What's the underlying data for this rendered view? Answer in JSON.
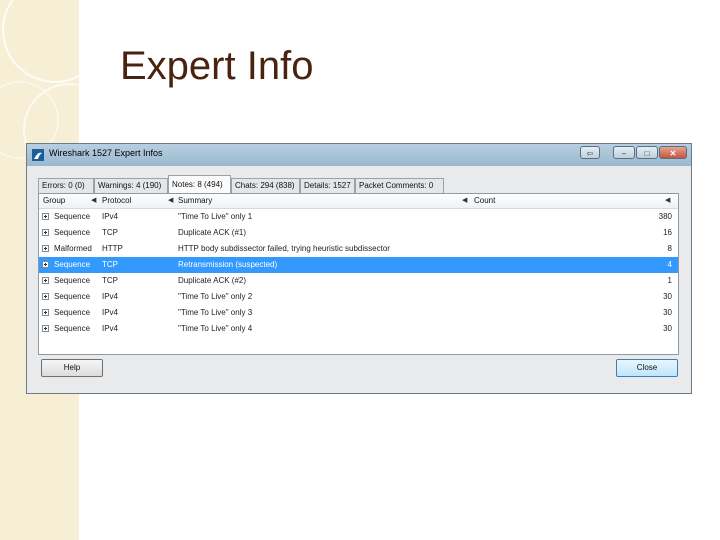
{
  "slide": {
    "title": "Expert Info"
  },
  "window": {
    "title": "Wireshark 1527 Expert Infos",
    "controls": {
      "back": "⇦",
      "minimize": "–",
      "maximize": "□",
      "close": "✕"
    }
  },
  "tabs": [
    {
      "label": "Errors: 0 (0)"
    },
    {
      "label": "Warnings: 4 (190)"
    },
    {
      "label": "Notes: 8 (494)"
    },
    {
      "label": "Chats: 294 (838)"
    },
    {
      "label": "Details: 1527"
    },
    {
      "label": "Packet Comments: 0"
    }
  ],
  "active_tab": "Notes: 8 (494)",
  "table": {
    "columns": {
      "group": "Group",
      "protocol": "Protocol",
      "summary": "Summary",
      "count": "Count"
    },
    "rows": [
      {
        "group": "Sequence",
        "protocol": "IPv4",
        "summary": "\"Time To Live\" only 1",
        "count": "380"
      },
      {
        "group": "Sequence",
        "protocol": "TCP",
        "summary": "Duplicate ACK (#1)",
        "count": "16"
      },
      {
        "group": "Malformed",
        "protocol": "HTTP",
        "summary": "HTTP body subdissector failed, trying heuristic subdissector",
        "count": "8"
      },
      {
        "group": "Sequence",
        "protocol": "TCP",
        "summary": "Retransmission (suspected)",
        "count": "4"
      },
      {
        "group": "Sequence",
        "protocol": "TCP",
        "summary": "Duplicate ACK (#2)",
        "count": "1"
      },
      {
        "group": "Sequence",
        "protocol": "IPv4",
        "summary": "\"Time To Live\" only 2",
        "count": "30"
      },
      {
        "group": "Sequence",
        "protocol": "IPv4",
        "summary": "\"Time To Live\" only 3",
        "count": "30"
      },
      {
        "group": "Sequence",
        "protocol": "IPv4",
        "summary": "\"Time To Live\" only 4",
        "count": "30"
      }
    ],
    "selected_row": "Retransmission (suspected)"
  },
  "buttons": {
    "help": "Help",
    "close": "Close"
  },
  "colors": {
    "selection": "#3399ff",
    "title_text": "#4a2310"
  }
}
